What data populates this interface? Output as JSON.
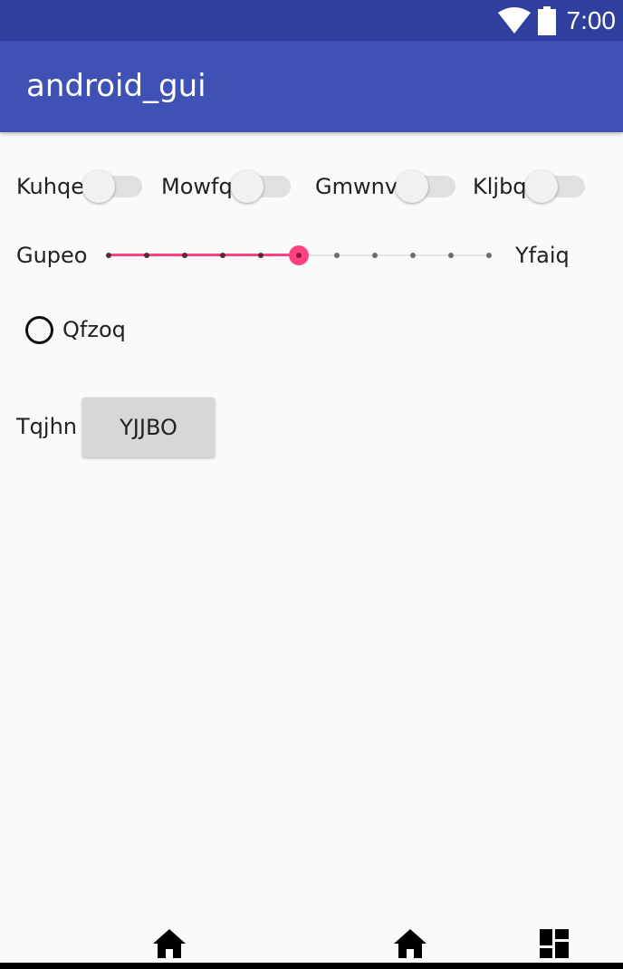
{
  "status_bar": {
    "time": "7:00",
    "icons": [
      "wifi-icon",
      "battery-icon"
    ]
  },
  "app_bar": {
    "title": "android_gui"
  },
  "switches": [
    {
      "label": "Kuhqe",
      "on": false
    },
    {
      "label": "Mowfq",
      "on": false
    },
    {
      "label": "Gmwnv",
      "on": false
    },
    {
      "label": "Kljbq",
      "on": false
    }
  ],
  "slider": {
    "min_label": "Gupeo",
    "max_label": "Yfaiq",
    "steps": 10,
    "value": 5,
    "accent_color": "#ff4081"
  },
  "radio": {
    "label": "Qfzoq",
    "checked": false
  },
  "form": {
    "label": "Tqjhn",
    "button_label": "YJJBO"
  },
  "nav_bar": {
    "icons": [
      "home-icon",
      "home-icon",
      "dashboard-icon"
    ]
  },
  "colors": {
    "status_bar": "#303f9f",
    "app_bar": "#3f51b5",
    "background": "#fafafa"
  }
}
